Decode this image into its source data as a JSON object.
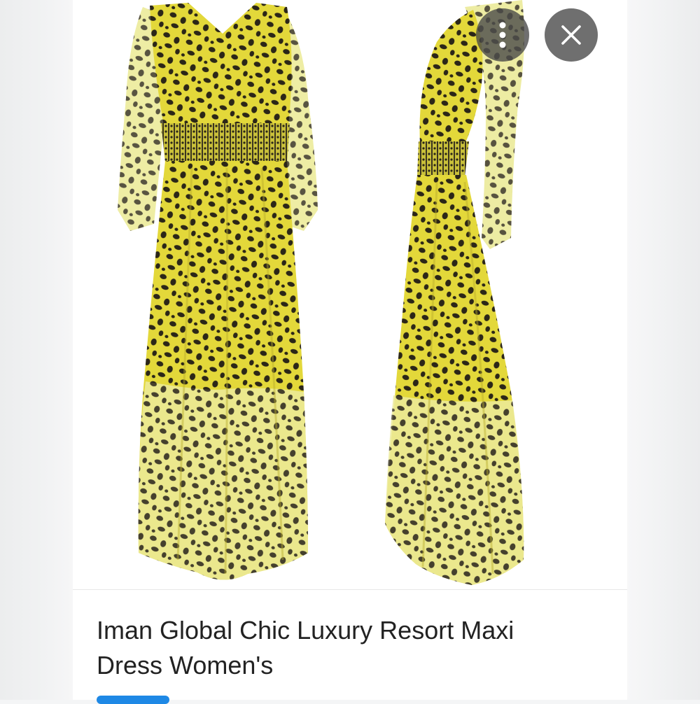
{
  "listing": {
    "title": "Iman Global Chic Luxury Resort Maxi Dress Women's"
  },
  "toolbar": {
    "more_icon": "more-vertical-icon",
    "close_icon": "close-icon"
  },
  "colors": {
    "dress_yellow": "#e3d83a",
    "spot": "#2b2618",
    "overlay_button": "#464646",
    "accent": "#1e88e5"
  }
}
